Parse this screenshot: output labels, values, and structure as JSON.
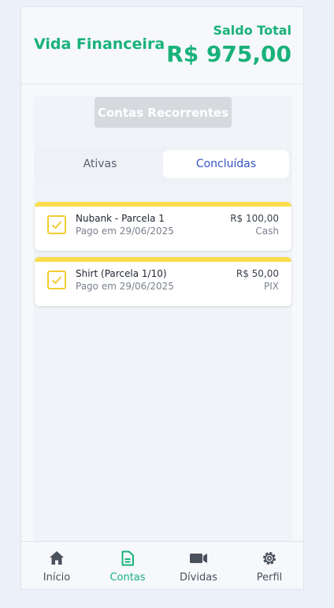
{
  "header": {
    "title": "Vida Financeira",
    "balance_label": "Saldo Total",
    "balance_value": "R$ 975,00"
  },
  "recurring_button": "Contas Recorrentes",
  "tabs": [
    {
      "label": "Ativas",
      "active": false
    },
    {
      "label": "Concluídas",
      "active": true
    }
  ],
  "items": [
    {
      "title": "Nubank - Parcela 1",
      "subtitle": "Pago em 29/06/2025",
      "amount": "R$ 100,00",
      "method": "Cash"
    },
    {
      "title": "Shirt (Parcela 1/10)",
      "subtitle": "Pago em 29/06/2025",
      "amount": "R$ 50,00",
      "method": "PIX"
    }
  ],
  "bottom_nav": [
    {
      "label": "Início",
      "icon": "home-icon",
      "active": false
    },
    {
      "label": "Contas",
      "icon": "document-icon",
      "active": true
    },
    {
      "label": "Dívidas",
      "icon": "video-icon",
      "active": false
    },
    {
      "label": "Perfil",
      "icon": "gear-icon",
      "active": false
    }
  ],
  "colors": {
    "accent": "#19b27a",
    "card_stripe": "#fadd4b",
    "tab_active": "#3554c8"
  }
}
